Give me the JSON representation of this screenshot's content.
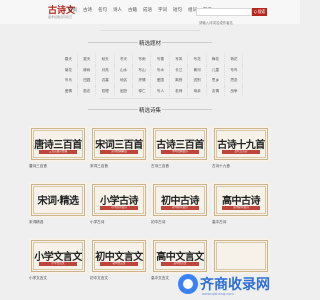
{
  "header": {
    "logo_text": "古诗文",
    "logo_sub": "国学经典诗词鉴赏",
    "nav": [
      "首页",
      "古诗",
      "名句",
      "诗人",
      "古籍",
      "成语",
      "字词",
      "短句",
      "组词",
      "歇后"
    ],
    "search_placeholder": "请输入诗词名或作者名",
    "search_button": "Q 搜索"
  },
  "section_topics": {
    "title": "精选题材"
  },
  "tags": [
    "春天",
    "夏天",
    "秋天",
    "冬天",
    "写雨",
    "写雪",
    "写风",
    "写花",
    "梅花",
    "荷花",
    "菊花",
    "柳树",
    "月亮",
    "山水",
    "写山",
    "写水",
    "长江",
    "黄河",
    "儿童",
    "写鸟",
    "写马",
    "田园",
    "边塞",
    "地名",
    "抒情",
    "爱国",
    "离别",
    "送别",
    "思乡",
    "思念",
    "爱情",
    "励志",
    "哲理",
    "闺怨",
    "悼亡",
    "写人",
    "老师",
    "母亲",
    "友情",
    "战争"
  ],
  "section_poems": {
    "title": "精选诗集"
  },
  "cards": [
    {
      "title": "唐诗三百首",
      "sub": "三百首唐诗经典",
      "label": "唐诗三百首"
    },
    {
      "title": "宋词三百首",
      "sub": "宋词经典精选",
      "label": "宋词三百首"
    },
    {
      "title": "古诗三百首",
      "sub": "中华经典古诗",
      "label": "古诗三百首"
    },
    {
      "title": "古诗十九首",
      "sub": "汉代五言诗",
      "label": "古诗十九首"
    },
    {
      "title": "宋词·精选",
      "sub": "",
      "label": "宋词精选"
    },
    {
      "title": "小学古诗",
      "sub": "小学必背古诗",
      "label": "小学古诗"
    },
    {
      "title": "初中古诗",
      "sub": "初中必背古诗",
      "label": "初中古诗"
    },
    {
      "title": "高中古诗",
      "sub": "高中必背古诗",
      "label": "高中古诗"
    },
    {
      "title": "小学文言文",
      "sub": "小学文言文",
      "label": "小学文言文"
    },
    {
      "title": "初中文言文",
      "sub": "初中文言文",
      "label": "初中文言文"
    },
    {
      "title": "高中文言文",
      "sub": "高中文言文",
      "label": "高中文言文"
    },
    {
      "title": "",
      "sub": "",
      "label": ""
    }
  ],
  "watermark": {
    "text": "齐商收录网",
    "sub": "www.qishang.com"
  }
}
